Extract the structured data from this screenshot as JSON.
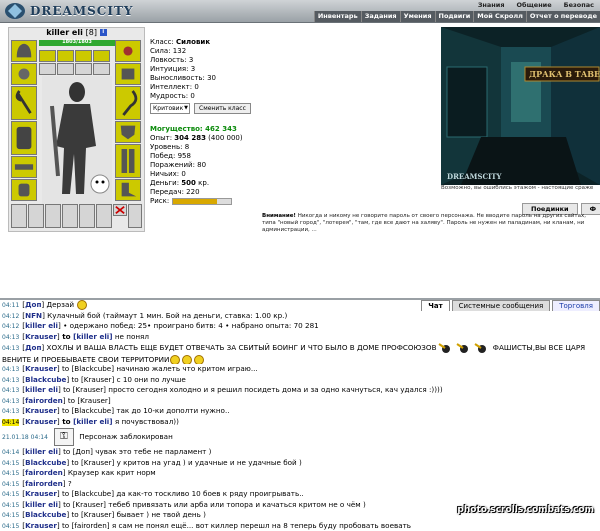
{
  "header": {
    "logo_text": "DREAMSCITY",
    "nav_top": [
      "Знания",
      "Общение",
      "Безопас"
    ],
    "nav_bottom": [
      "Инвентарь",
      "Задания",
      "Умения",
      "Подвиги",
      "Мой Скролл",
      "Отчет о переводе"
    ]
  },
  "character": {
    "name": "killer eli",
    "level": "[8]",
    "hp": "1803/1803",
    "hp_fraction": 1.0
  },
  "stats": {
    "class": "Класс: ",
    "class_value": "Силовик",
    "strength": "Сила: 132",
    "agility": "Ловкость: 3",
    "intuition": "Интуиция: 3",
    "endurance": "Выносливость: 30",
    "intellect": "Интеллект: 0",
    "wisdom": "Мудрость: 0",
    "select_value": "Критовик",
    "change_class_button": "Сменить класс",
    "power": "Могущество: 462 343",
    "exp_label": "Опыт: ",
    "exp_value": "304 283",
    "exp_next": " (400 000)",
    "levels": "Уровень: 8",
    "wins": "Побед: 958",
    "losses": "Поражений: 80",
    "draws": "Ничьих: 0",
    "money_label": "Деньги: ",
    "money_value": "500",
    "money_unit": " кр.",
    "transfers": "Передач: 220",
    "risk_label": "Риск:",
    "risk_fraction": 0.75
  },
  "scene": {
    "sign_text": "ДРАКА В ТАВЕР",
    "watermark": "DREAMSCITY",
    "caption": "Возможно, вы ошиблись этажом - настоящие сраже"
  },
  "right_tabs": [
    "Поединки",
    "Ф"
  ],
  "warning": {
    "bold": "Внимание!",
    "text": " Никогда и никому не говорите пароль от своего персонажа. Не вводите пароль на других сайтах, типа \"новый город\", \"лотерея\", \"там, где все дают на халяву\". Пароль не нужен ни паладинам, ни кланам, ни администрации, ..."
  },
  "chat_tabs": [
    "Чат",
    "Системные сообщения",
    "Торговля"
  ],
  "chat": [
    {
      "time": "04:11",
      "nick": "Доп",
      "text": " Дерзай"
    },
    {
      "time": "04:12",
      "nick": "NFN",
      "text": " Кулачный бой (таймаут 1 мин. Бой на деньги, ставка: 1.00 кр.)"
    },
    {
      "time": "04:12",
      "nick": "killer eli",
      "text": " • одержано побед: 25• проиграно битв: 4 • набрано опыта: 70 281"
    },
    {
      "time": "04:13",
      "nick": "Krauser",
      "to": " to ",
      "target": "[killer eli]",
      "text": " не понял"
    },
    {
      "time": "04:13",
      "nick": "Доп",
      "text": " ХОХЛЫ И ВАША ВЛАСТЬ ЕЩЕ БУДЕТ ОТВЕЧАТЬ ЗА СБИТЫЙ БОИНГ И ЧТО БЫЛО В ДОМЕ ПРОФСОЮЗОВ",
      "text2": " ФАШИСТЫ,ВЫ ВСЕ ЦАРЯ ВЕНИТЕ И ПРОЕБЫВАЕТЕ СВОИ ТЕРРИТОРИИ"
    },
    {
      "time": "04:13",
      "nick": "Krauser",
      "text": " to [Blackcube] начинаю жалеть что критом играю..."
    },
    {
      "time": "04:13",
      "nick": "Blackcube",
      "text": " to [Krauser] с 10 они по лучше"
    },
    {
      "time": "04:13",
      "nick": "killer eli",
      "text": " to [Krauser] просто сегодня холодно и я решил посидеть дома и за одно качнуться, кач удался :))))"
    },
    {
      "time": "04:13",
      "nick": "fairorden",
      "text": " to [Krauser]"
    },
    {
      "time": "04:13",
      "nick": "Krauser",
      "text": " to [Blackcube] так до 10-ки дополти нужно.."
    },
    {
      "time": "04:14",
      "nick": "Krauser",
      "to": " to ",
      "target": "[killer eli]",
      "text": " я почувствовал))"
    },
    {
      "time": "21.01.18 04:14",
      "text": " Персонаж заблокирован"
    },
    {
      "time": "04:14",
      "nick": "killer eli",
      "text": " to [Доп] чувак это тебе не парламент )"
    },
    {
      "time": "04:15",
      "nick": "Blackcube",
      "text": " to [Krauser] у критов на угад ) и удачные и не удачные бой )"
    },
    {
      "time": "04:15",
      "nick": "fairorden",
      "text": " Краузер как крит норм"
    },
    {
      "time": "04:15",
      "nick": "fairorden",
      "text": " ?"
    },
    {
      "time": "04:15",
      "nick": "Krauser",
      "text": " to [Blackcube] да как-то тоскливо 10 боев к ряду проигрывать.."
    },
    {
      "time": "04:15",
      "nick": "killer eli",
      "text": " to [Krauser] тебеб привязать или арба или топора и качаться критом не о чём )"
    },
    {
      "time": "04:15",
      "nick": "Blackcube",
      "text": " to [Krauser] бывает ) не твой день )"
    },
    {
      "time": "04:15",
      "nick": "Krauser",
      "text": " to [fairorden] я сам не понял ещё... вот киллер перешл на 8 теперь буду пробовать воевать"
    }
  ],
  "site_watermark": "photo.scrolls.combats.com",
  "colors": {
    "nick": "#1f2f8a",
    "time": "#2a6a8a",
    "power": "#0a8a0a",
    "slot": "#ccc900"
  }
}
